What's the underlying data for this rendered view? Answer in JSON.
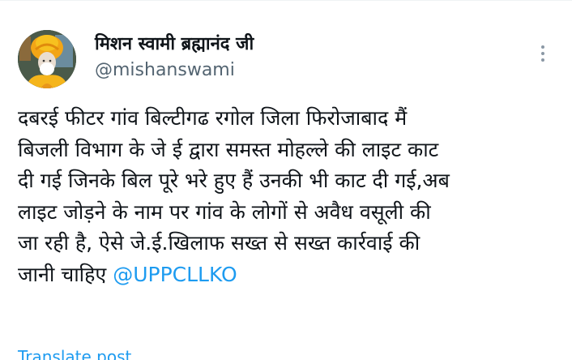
{
  "tweet": {
    "author": {
      "display_name": "मिशन स्वामी ब्रह्मानंद जी",
      "handle": "@mishanswami",
      "avatar_icon": "profile-photo-icon"
    },
    "more_icon": "more-options-icon",
    "text_lines": [
      "दबरई फीटर गांव बिल्टीगढ रगोल जिला फिरोजाबाद मैं",
      "बिजली विभाग के जे ई द्वारा समस्त मोहल्ले की लाइट काट",
      "दी गई जिनके बिल पूरे भरे हुए हैं उनकी भी काट दी गई,अब",
      "लाइट जोड़ने के नाम पर गांव के लोगों से अवैध वसूली की",
      "जा रही है, ऐसे जे.ई.खिलाफ सख्त से सख्त कार्रवाई की",
      "जानी चाहिए "
    ],
    "mention": "@UPPCLLKO",
    "translate_label": "Translate post"
  },
  "colors": {
    "text": "#0f1419",
    "secondary": "#536471",
    "accent": "#1d9bf0"
  }
}
